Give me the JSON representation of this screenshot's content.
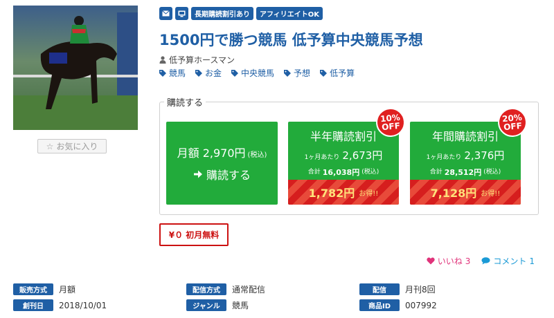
{
  "product": {
    "image_alt": "racehorse-photo",
    "favorite_label": "お気に入り",
    "tags": [
      "長期購読割引あり",
      "アフィリエイトOK"
    ],
    "tag_icons": [
      "mail-icon",
      "monitor-icon"
    ],
    "title": "1500円で勝つ競馬 低予算中央競馬予想",
    "author": "低予算ホースマン",
    "categories": [
      "競馬",
      "お金",
      "中央競馬",
      "予想",
      "低予算"
    ]
  },
  "subscription": {
    "legend": "購読する",
    "monthly": {
      "price_prefix": "月額 2,970円",
      "tax": "(税込)",
      "cta": "購読する"
    },
    "half_year": {
      "title": "半年購読割引",
      "per_month_label": "1ヶ月あたり",
      "per_month_price": "2,673円",
      "total_label": "合計",
      "total_price": "16,038円",
      "tax": "(税込)",
      "saving_amount": "1,782円",
      "saving_label": "お得!!",
      "badge_pct": "10%",
      "badge_word": "OFF"
    },
    "year": {
      "title": "年間購読割引",
      "per_month_label": "1ヶ月あたり",
      "per_month_price": "2,376円",
      "total_label": "合計",
      "total_price": "28,512円",
      "tax": "(税込)",
      "saving_amount": "7,128円",
      "saving_label": "お得!!",
      "badge_pct": "20%",
      "badge_word": "OFF"
    }
  },
  "free_trial": "¥０ 初月無料",
  "social": {
    "like_label": "いいね",
    "like_count": "3",
    "comment_label": "コメント",
    "comment_count": "1"
  },
  "info": [
    {
      "label": "販売方式",
      "value": "月額"
    },
    {
      "label": "配信方式",
      "value": "通常配信"
    },
    {
      "label": "配信",
      "value": "月刊8回"
    },
    {
      "label": "創刊日",
      "value": "2018/10/01"
    },
    {
      "label": "ジャンル",
      "value": "競馬"
    },
    {
      "label": "商品ID",
      "value": "007992"
    }
  ],
  "colors": {
    "brand_blue": "#1f5fa5",
    "green": "#22ab3b",
    "red": "#d61e1e",
    "like_pink": "#e0337a",
    "comment_blue": "#1a9ad6"
  }
}
